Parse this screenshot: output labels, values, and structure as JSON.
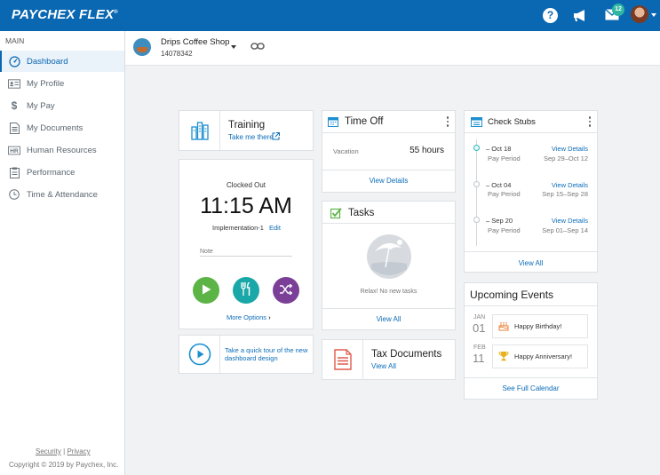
{
  "brand": {
    "name": "PAYCHEX FLEX",
    "mark": "®",
    "primary_color": "#0a67b1",
    "accent_color": "#2eb8a3"
  },
  "topbar": {
    "notification_count": "12",
    "icons": [
      "help-icon",
      "megaphone-icon",
      "mail-icon",
      "user-avatar"
    ]
  },
  "sidebar": {
    "section": "MAIN",
    "items": [
      {
        "label": "Dashboard",
        "icon": "dashboard-icon"
      },
      {
        "label": "My Profile",
        "icon": "id-card-icon"
      },
      {
        "label": "My Pay",
        "icon": "dollar-icon"
      },
      {
        "label": "My Documents",
        "icon": "document-icon"
      },
      {
        "label": "Human Resources",
        "icon": "hr-icon"
      },
      {
        "label": "Performance",
        "icon": "clipboard-icon"
      },
      {
        "label": "Time & Attendance",
        "icon": "clock-icon"
      }
    ],
    "footer": {
      "security": "Security",
      "separator": "|",
      "privacy": "Privacy",
      "copyright": "Copyright © 2019 by Paychex, Inc."
    }
  },
  "company": {
    "name": "Drips Coffee Shop",
    "id": "14078342"
  },
  "training": {
    "title": "Training",
    "link": "Take me there"
  },
  "clock": {
    "status": "Clocked Out",
    "time": "11:15 AM",
    "job": "Implementation-1",
    "edit": "Edit",
    "note_placeholder": "Note",
    "more_options": "More Options",
    "buttons": [
      {
        "name": "clock-in",
        "color": "#5bb445",
        "icon": "play-icon"
      },
      {
        "name": "meal-break",
        "color": "#1aa7a7",
        "icon": "fork-knife-icon"
      },
      {
        "name": "transfer",
        "color": "#7b3f98",
        "icon": "shuffle-icon"
      }
    ]
  },
  "tour": {
    "text": "Take a quick tour of the new dashboard design"
  },
  "time_off": {
    "title": "Time Off",
    "type": "Vacation",
    "balance": "55 hours",
    "view_details": "View Details"
  },
  "tasks": {
    "title": "Tasks",
    "empty_message": "Relax! No new tasks",
    "view_all": "View All"
  },
  "tax_documents": {
    "title": "Tax Documents",
    "view_all": "View All"
  },
  "check_stubs": {
    "title": "Check Stubs",
    "items": [
      {
        "date": "Oct 18",
        "label": "Pay Period",
        "view": "View Details",
        "period": "Sep 29–Oct 12"
      },
      {
        "date": "Oct 04",
        "label": "Pay Period",
        "view": "View Details",
        "period": "Sep 15–Sep 28"
      },
      {
        "date": "Sep 20",
        "label": "Pay Period",
        "view": "View Details",
        "period": "Sep 01–Sep 14"
      }
    ],
    "view_all": "View All"
  },
  "events": {
    "title": "Upcoming Events",
    "items": [
      {
        "month": "JAN",
        "day": "01",
        "label": "Happy Birthday!",
        "icon": "cake-icon"
      },
      {
        "month": "FEB",
        "day": "11",
        "label": "Happy Anniversary!",
        "icon": "trophy-icon"
      }
    ],
    "see_calendar": "See Full Calendar"
  }
}
